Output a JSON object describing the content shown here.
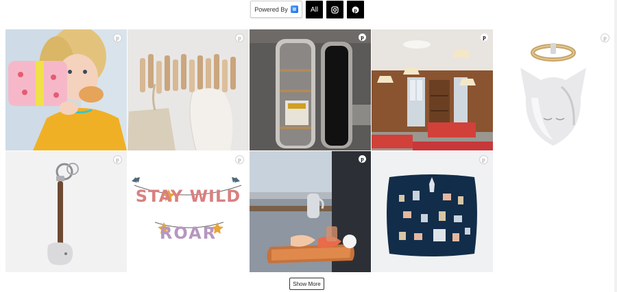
{
  "toolbar": {
    "powered_by": "Powered By",
    "filter_all": "All",
    "instagram_icon": "instagram-icon",
    "pinterest_icon": "pinterest-icon"
  },
  "tiles": [
    {
      "subject": "child-lunchbox",
      "pin": "light"
    },
    {
      "subject": "wooden-coat-hooks",
      "pin": "light"
    },
    {
      "subject": "mirror-towel-rack",
      "pin": "dark"
    },
    {
      "subject": "office-interior",
      "pin": "dark"
    },
    {
      "subject": "cat-ring-holder",
      "pin": "light"
    },
    {
      "subject": "elephant-keychain",
      "pin": "light"
    },
    {
      "subject": "letter-banner",
      "pin": "light"
    },
    {
      "subject": "breakfast-tray",
      "pin": "dark"
    },
    {
      "subject": "city-pillow",
      "pin": "light"
    }
  ],
  "banner": {
    "line1": "STAY WILD",
    "line2": "ROAR"
  },
  "show_more": "Show More"
}
